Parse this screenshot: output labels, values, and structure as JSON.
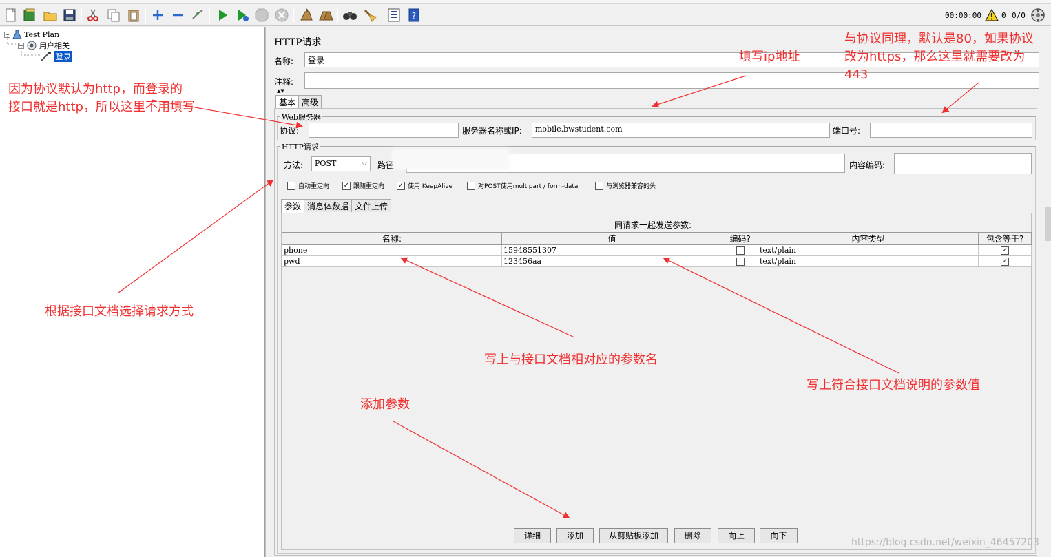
{
  "toolbar": {
    "timer": "00:00:00",
    "warning_count": "0",
    "thread_count": "0/0",
    "icons": [
      "new-icon",
      "templates-icon",
      "open-icon",
      "save-icon",
      "cut-icon",
      "copy-icon",
      "paste-icon",
      "expand-icon",
      "collapse-icon",
      "toggle-icon",
      "start-icon",
      "start-no-pauses-icon",
      "stop-icon",
      "shutdown-icon",
      "clear-icon",
      "clear-all-icon",
      "search-icon",
      "reset-search-icon",
      "function-helper-icon",
      "help-icon",
      "warning-icon",
      "remote-icon"
    ]
  },
  "tree": {
    "plan": "Test Plan",
    "group": "用户相关",
    "sampler": "登录"
  },
  "panel": {
    "title": "HTTP请求",
    "name_label": "名称:",
    "name_value": "登录",
    "comment_label": "注释:",
    "comment_value": "",
    "tabs": [
      "基本",
      "高级"
    ],
    "web_server": {
      "legend": "Web服务器",
      "protocol_label": "协议:",
      "protocol_value": "",
      "server_label": "服务器名称或IP:",
      "server_value": "mobile.bwstudent.com",
      "port_label": "端口号:",
      "port_value": ""
    },
    "http_request": {
      "legend": "HTTP请求",
      "method_label": "方法:",
      "method_value": "POST",
      "path_label": "路径",
      "encoding_label": "内容编码:",
      "encoding_value": "",
      "checkboxes": [
        {
          "label": "自动重定向",
          "checked": false
        },
        {
          "label": "跟随重定向",
          "checked": true
        },
        {
          "label": "使用 KeepAlive",
          "checked": true
        },
        {
          "label": "对POST使用multipart / form-data",
          "checked": false
        },
        {
          "label": "与浏览器兼容的头",
          "checked": false
        }
      ]
    },
    "sub_tabs": [
      "参数",
      "消息体数据",
      "文件上传"
    ],
    "params": {
      "caption": "同请求一起发送参数:",
      "headers": [
        "名称:",
        "值",
        "编码?",
        "内容类型",
        "包含等于?"
      ],
      "rows": [
        {
          "name": "phone",
          "value": "15948551307",
          "encode": false,
          "content_type": "text/plain",
          "include_equals": true
        },
        {
          "name": "pwd",
          "value": "123456aa",
          "encode": false,
          "content_type": "text/plain",
          "include_equals": true
        }
      ]
    },
    "buttons": [
      "详细",
      "添加",
      "从剪贴板添加",
      "删除",
      "向上",
      "向下"
    ]
  },
  "annotations": {
    "protocol_note_1": "因为协议默认为http，而登录的",
    "protocol_note_2": "接口就是http，所以这里不用填写",
    "ip_note": "填写ip地址",
    "port_note_1": "与协议同理，默认是80，如果协议",
    "port_note_2": "改为https，那么这里就需要改为",
    "port_note_3": "443",
    "method_note": "根据接口文档选择请求方式",
    "param_name_note": "写上与接口文档相对应的参数名",
    "param_value_note": "写上符合接口文档说明的参数值",
    "add_note": "添加参数",
    "watermark": "https://blog.csdn.net/weixin_46457203"
  },
  "colors": {
    "annotation": "#f03030",
    "selection": "#0a57c9"
  }
}
